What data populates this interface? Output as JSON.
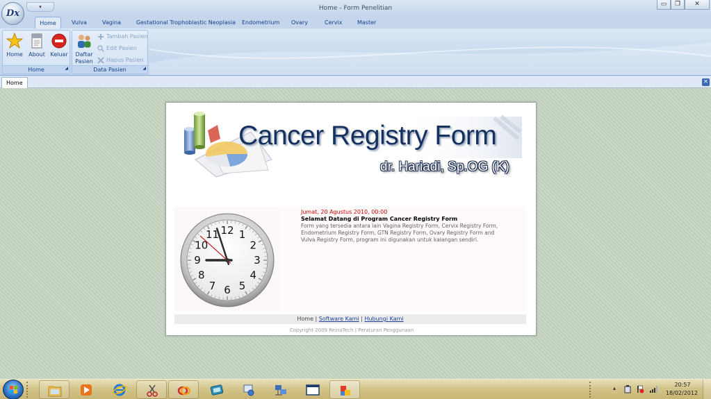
{
  "window": {
    "title": "Home - Form Penelitian",
    "app_logo_text": "Dx",
    "qat_glyph": "▾",
    "minimize_glyph": "▭",
    "restore_glyph": "❐",
    "close_glyph": "✕"
  },
  "ribbon": {
    "tabs": [
      "Home",
      "Vulva",
      "Vagina",
      "Gestational Trophoblastic Neoplasia",
      "Endometrium",
      "Ovary",
      "Cervix",
      "Master"
    ],
    "active_tab": "Home",
    "groups": {
      "home": {
        "label": "Home",
        "buttons": [
          {
            "label": "Home",
            "icon": "star-icon"
          },
          {
            "label": "About",
            "icon": "document-icon"
          },
          {
            "label": "Keluar",
            "icon": "stop-icon"
          }
        ]
      },
      "data_pasien": {
        "label": "Data Pasien",
        "big_button": {
          "line1": "Daftar",
          "line2": "Pasien",
          "icon": "people-icon"
        },
        "small_buttons": [
          {
            "label": "Tambah Pasien",
            "icon": "add-icon",
            "enabled": false
          },
          {
            "label": "Edit Pasien",
            "icon": "edit-icon",
            "enabled": false
          },
          {
            "label": "Hapus Pasien",
            "icon": "delete-icon",
            "enabled": false
          }
        ]
      }
    }
  },
  "document_tabs": {
    "active": "Home",
    "close_glyph": "✕"
  },
  "panel": {
    "banner_title": "Cancer Registry Form",
    "banner_subtitle": "dr. Hariadi, Sp.OG (K)",
    "info": {
      "date": "Jumat, 20 Agustus 2010, 00:00",
      "heading": "Selamat Datang di Program Cancer Registry Form",
      "body": "Form yang tersedia antara lain Vagina Registry Form, Cervix Registry Form, Endometrium Registry Form, GTN Registry Form, Ovary Registry Form and Vulva Registry Form, program ini digunakan untuk kalangan sendiri."
    },
    "clock": {
      "numbers": [
        "12",
        "1",
        "2",
        "3",
        "4",
        "5",
        "6",
        "7",
        "8",
        "9",
        "10",
        "11"
      ],
      "hour_hand": 9.0,
      "minute_hand": 57,
      "second_hand": 52
    },
    "footer_links": {
      "home": "Home",
      "sep": "|",
      "software": "Software Kami",
      "contact": "Hubungi Kami"
    },
    "copyright": {
      "text": "Copyright 2009 ReinaTech",
      "sep": "|",
      "terms": "Peraturan Penggunaan"
    }
  },
  "taskbar": {
    "time": "20:57",
    "date": "18/02/2012",
    "tray_arrow": "▴",
    "colors": {
      "accent": "#d4c58c"
    }
  }
}
